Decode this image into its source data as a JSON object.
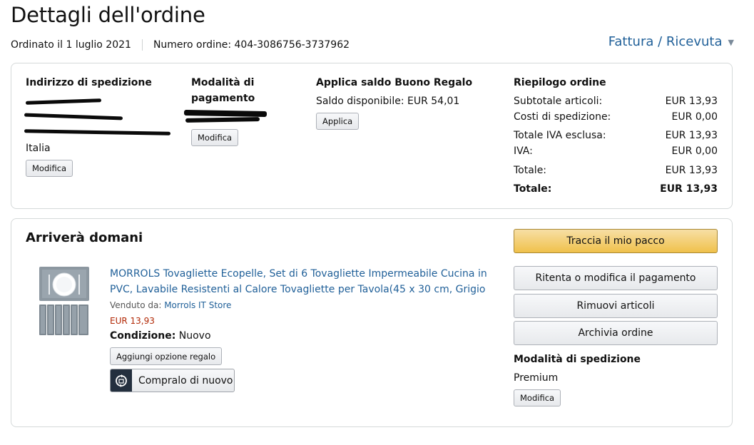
{
  "header": {
    "title": "Dettagli dell'ordine",
    "ordered_on": "Ordinato il 1 luglio 2021",
    "order_number": "Numero ordine: 404-3086756-3737962",
    "invoice_link": "Fattura / Ricevuta"
  },
  "shipping_address": {
    "title": "Indirizzo di spedizione",
    "country": "Italia",
    "edit_label": "Modifica"
  },
  "payment": {
    "title_line1": "Modalità di",
    "title_line2": "pagamento",
    "edit_label": "Modifica"
  },
  "gift_card": {
    "title": "Applica saldo Buono Regalo",
    "balance": "Saldo disponibile: EUR 54,01",
    "apply_label": "Applica"
  },
  "summary": {
    "title": "Riepilogo ordine",
    "rows": [
      {
        "label": "Subtotale articoli:",
        "value": "EUR 13,93"
      },
      {
        "label": "Costi di spedizione:",
        "value": "EUR 0,00"
      },
      {
        "label": "Totale IVA esclusa:",
        "value": "EUR 13,93"
      },
      {
        "label": "IVA:",
        "value": "EUR 0,00"
      },
      {
        "label": "Totale:",
        "value": "EUR 13,93"
      },
      {
        "label": "Totale:",
        "value": "EUR 13,93"
      }
    ]
  },
  "shipment": {
    "status": "Arriverà domani",
    "product": {
      "title": "MORROLS Tovagliette Ecopelle, Set di 6 Tovagliette Impermeabile Cucina in PVC, Lavabile Resistenti al Calore Tovagliette per Tavola(45 x 30 cm, Grigio",
      "sold_by_label": "Venduto da: ",
      "seller": "Morrols IT Store",
      "price": "EUR 13,93",
      "condition_label": "Condizione:",
      "condition_value": "Nuovo",
      "gift_option_label": "Aggiungi opzione regalo",
      "buy_again_label": "Compralo di nuovo"
    },
    "actions": {
      "track": "Traccia il mio pacco",
      "retry_payment": "Ritenta o modifica il pagamento",
      "remove_items": "Rimuovi articoli",
      "archive": "Archivia ordine"
    },
    "shipping_method": {
      "title": "Modalità di spedizione",
      "value": "Premium",
      "edit_label": "Modifica"
    }
  },
  "colors": {
    "link": "#1f5f98",
    "price": "#b12704",
    "primary_button": "#f0c14b",
    "redaction": "#0a0a0a"
  },
  "icons": [
    "chevron-down-icon",
    "buy-again-icon"
  ]
}
